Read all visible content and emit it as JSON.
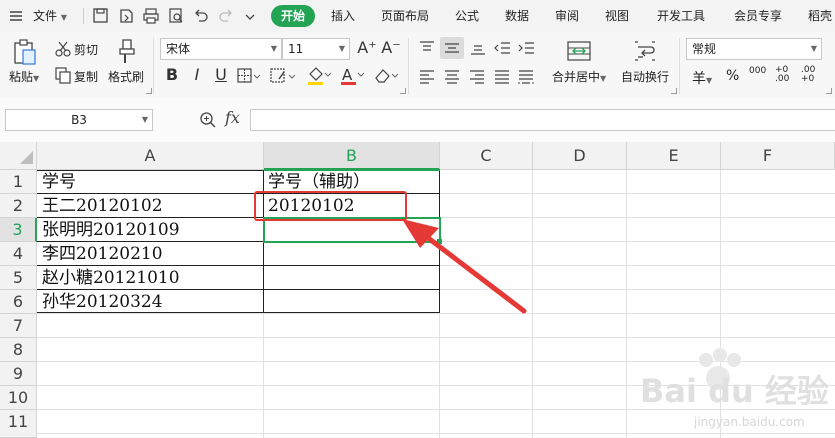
{
  "menu": {
    "file_label": "文件",
    "tabs": [
      "开始",
      "插入",
      "页面布局",
      "公式",
      "数据",
      "审阅",
      "视图",
      "开发工具",
      "会员专享",
      "稻壳"
    ]
  },
  "ribbon": {
    "paste_label": "粘贴",
    "cut_label": "剪切",
    "copy_label": "复制",
    "format_painter_label": "格式刷",
    "font_name": "宋体",
    "font_size": "11",
    "merge_label": "合并居中",
    "wrap_label": "自动换行",
    "number_format": "常规",
    "currency_symbol": "羊",
    "percent_symbol": "%",
    "thousands_symbol": "000",
    "increase_decimal": "+0 .00",
    "decrease_decimal": ".00 +0"
  },
  "formula_bar": {
    "name_box": "B3",
    "fx_label": "fx",
    "formula": ""
  },
  "sheet": {
    "columns": [
      "A",
      "B",
      "C",
      "D",
      "E",
      "F"
    ],
    "rows": [
      "1",
      "2",
      "3",
      "4",
      "5",
      "6",
      "7",
      "8",
      "9",
      "10",
      "11"
    ],
    "selected_cell": "B3",
    "cells": {
      "A1": "学号",
      "A2": "王二20120102",
      "A3": "张明明20120109",
      "A4": "李四20120210",
      "A5": "赵小糖20121010",
      "A6": "孙华20120324",
      "B1": "学号（辅助）",
      "B2": "20120102"
    }
  },
  "watermark": {
    "brand": "Bai du 经验",
    "url": "jingyan.baidu.com"
  },
  "colors": {
    "accent_green": "#22a454",
    "highlight_red": "#e53935"
  }
}
